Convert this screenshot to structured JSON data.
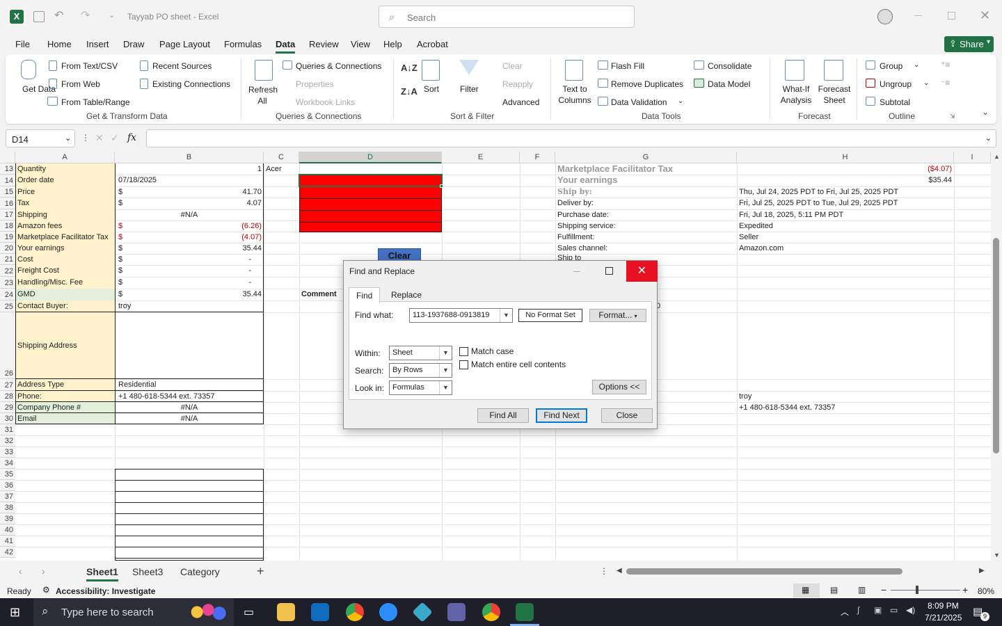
{
  "window": {
    "title": "Tayyab PO sheet  -  Excel",
    "search_placeholder": "Search",
    "brand_color": "#217346"
  },
  "menu": {
    "tabs": [
      "File",
      "Home",
      "Insert",
      "Draw",
      "Page Layout",
      "Formulas",
      "Data",
      "Review",
      "View",
      "Help",
      "Acrobat"
    ],
    "active": "Data",
    "share_label": "Share"
  },
  "ribbon": {
    "get_data": "Get Data",
    "from_text_csv": "From Text/CSV",
    "from_web": "From Web",
    "from_table_range": "From Table/Range",
    "recent_sources": "Recent Sources",
    "existing_connections": "Existing Connections",
    "group_get_transform": "Get & Transform Data",
    "refresh_all": "Refresh All",
    "queries_connections": "Queries & Connections",
    "properties": "Properties",
    "workbook_links": "Workbook Links",
    "group_queries": "Queries & Connections",
    "sort": "Sort",
    "filter": "Filter",
    "clear": "Clear",
    "reapply": "Reapply",
    "advanced": "Advanced",
    "group_sort_filter": "Sort & Filter",
    "text_to_columns": "Text to Columns",
    "flash_fill": "Flash Fill",
    "remove_duplicates": "Remove Duplicates",
    "data_validation": "Data Validation",
    "consolidate": "Consolidate",
    "data_model": "Data Model",
    "group_data_tools": "Data Tools",
    "what_if": "What-If Analysis",
    "forecast_sheet": "Forecast Sheet",
    "group_forecast": "Forecast",
    "group": "Group",
    "ungroup": "Ungroup",
    "subtotal": "Subtotal",
    "group_outline": "Outline"
  },
  "formula_bar": {
    "name_box": "D14",
    "fx_label": "fx",
    "value": ""
  },
  "columns": [
    "A",
    "B",
    "C",
    "D",
    "E",
    "F",
    "G",
    "H",
    "I"
  ],
  "selected_column": "D",
  "rows": [
    "13",
    "14",
    "15",
    "16",
    "17",
    "18",
    "19",
    "20",
    "21",
    "22",
    "23",
    "24",
    "25",
    "26",
    "27",
    "28",
    "29",
    "30",
    "31",
    "32",
    "33",
    "34",
    "35",
    "36",
    "37",
    "38",
    "39",
    "40",
    "41",
    "42"
  ],
  "cells": {
    "a13": "Quantity",
    "b13": "1",
    "c13": "Acer",
    "a14": "Order date",
    "b14": "07/18/2025",
    "a15": "Price",
    "b15c": "$",
    "b15": "41.70",
    "a16": "Tax",
    "b16c": "$",
    "b16": "4.07",
    "a17": "Shipping",
    "b17": "#N/A",
    "a18": "Amazon fees",
    "b18c": "$",
    "b18": "(6.26)",
    "a19": "Marketplace Facilitator Tax",
    "b19c": "$",
    "b19": "(4.07)",
    "a20": "Your earnings",
    "b20c": "$",
    "b20": "35.44",
    "a21": "Cost",
    "b21c": "$",
    "b21": "-",
    "a22": "Freight Cost",
    "b22c": "$",
    "b22": "-",
    "a23": "Handling/Misc. Fee",
    "b23c": "$",
    "b23": "-",
    "a24": "GMD",
    "b24c": "$",
    "b24": "35.44",
    "a25": "Contact Buyer:",
    "b25": "troy",
    "a26": "Shipping Address",
    "a27": "Address Type",
    "b27": "Residential",
    "a28": "Phone:",
    "b28": "+1 480-618-5344 ext. 73357",
    "a29": "Company Phone #",
    "b29": "#N/A",
    "a30": "Email",
    "b30": "#N/A",
    "clear_button": "Clear",
    "c24": "Comment",
    "g13": "Marketplace Facilitator Tax",
    "h13": "($4.07)",
    "g14": "Your earnings",
    "h14": "$35.44",
    "g15": "Ship by:",
    "h15": "Thu, Jul 24, 2025 PDT to Fri, Jul 25, 2025 PDT",
    "g16": "Deliver by:",
    "h16": "Fri, Jul 25, 2025 PDT to Tue, Jul 29, 2025 PDT",
    "g17": "Purchase date:",
    "h17": "Fri, Jul 18, 2025, 5:11 PM PDT",
    "g18": "Shipping service:",
    "h18": "Expedited",
    "g19": "Fulfillment:",
    "h19": "Seller",
    "g20": "Sales channel:",
    "h20": "Amazon.com",
    "g21": "Ship to",
    "g25_partial": "0",
    "h28": "troy",
    "h29": "+1 480-618-5344 ext. 73357"
  },
  "sheets": [
    "Sheet1",
    "Sheet3",
    "Category"
  ],
  "active_sheet": "Sheet1",
  "status": {
    "ready": "Ready",
    "accessibility": "Accessibility: Investigate",
    "zoom": "80%"
  },
  "dialog": {
    "title": "Find and Replace",
    "tab_find": "Find",
    "tab_replace": "Replace",
    "find_what_label": "Find what:",
    "find_what_value": "113-1937688-0913819",
    "no_format": "No Format Set",
    "format_button": "Format...",
    "within_label": "Within:",
    "within_value": "Sheet",
    "search_label": "Search:",
    "search_value": "By Rows",
    "lookin_label": "Look in:",
    "lookin_value": "Formulas",
    "match_case": "Match case",
    "match_entire": "Match entire cell contents",
    "options_button": "Options <<",
    "find_all": "Find All",
    "find_next": "Find Next",
    "close": "Close"
  },
  "taskbar": {
    "search_placeholder": "Type here to search",
    "time": "8:09 PM",
    "date": "7/21/2025",
    "notifications": "9"
  }
}
